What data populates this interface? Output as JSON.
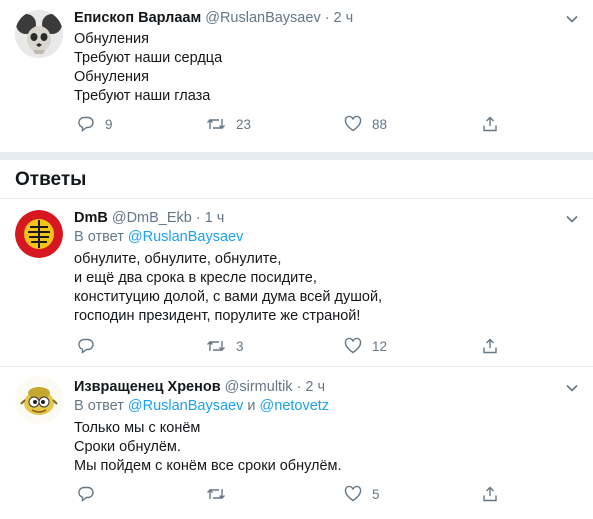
{
  "main_tweet": {
    "author": "Епископ Варлаам",
    "handle": "@RuslanBaysaev",
    "dot": "·",
    "time": "2 ч",
    "lines": [
      "Обнуления",
      "Требуют наши сердца",
      "Обнуления",
      "Требуют наши глаза"
    ],
    "replies": "9",
    "retweets": "23",
    "likes": "88"
  },
  "replies_section": {
    "title": "Ответы"
  },
  "replies": [
    {
      "author": "DmB",
      "handle": "@DmB_Ekb",
      "dot": "·",
      "time": "1 ч",
      "reply_prefix": "В ответ",
      "mention_1": "@RuslanBaysaev",
      "lines": [
        "обнулите, обнулите, обнулите,",
        "и ещё два срока в кресле посидите,",
        "конституцию долой, с вами дума всей душой,",
        "господин президент, порулите же страной!"
      ],
      "replies": "",
      "retweets": "3",
      "likes": "12"
    },
    {
      "author": "Извращенец Хренов",
      "handle": "@sirmultik",
      "dot": "·",
      "time": "2 ч",
      "reply_prefix": "В ответ",
      "mention_1": "@RuslanBaysaev",
      "conjunction": "и",
      "mention_2": "@netovetz",
      "lines": [
        "Только мы с конём",
        "Сроки обнулём.",
        "Мы пойдем с конём все сроки обнулём."
      ],
      "replies": "",
      "retweets": "",
      "likes": "5"
    }
  ],
  "colors": {
    "text": "#14171a",
    "muted": "#657786",
    "link": "#1da1f2",
    "divider": "#e6ecf0"
  }
}
